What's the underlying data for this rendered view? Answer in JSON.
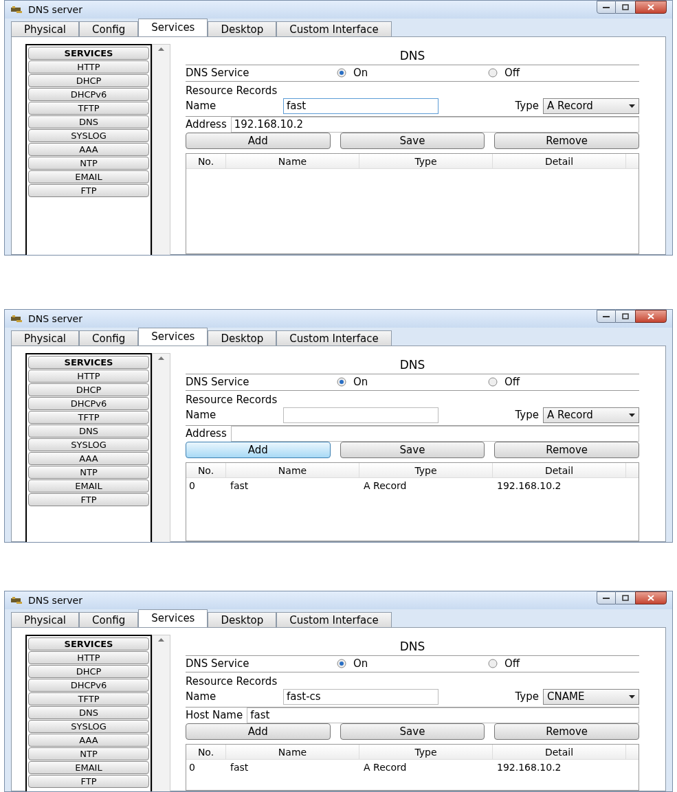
{
  "windows": [
    {
      "title": "DNS server",
      "tabs": [
        {
          "label": "Physical",
          "selected": false
        },
        {
          "label": "Config",
          "selected": false
        },
        {
          "label": "Services",
          "selected": true
        },
        {
          "label": "Desktop",
          "selected": false
        },
        {
          "label": "Custom Interface",
          "selected": false
        }
      ],
      "services": [
        {
          "label": "SERVICES",
          "kind": "header"
        },
        {
          "label": "HTTP",
          "kind": "item"
        },
        {
          "label": "DHCP",
          "kind": "item"
        },
        {
          "label": "DHCPv6",
          "kind": "item"
        },
        {
          "label": "TFTP",
          "kind": "item"
        },
        {
          "label": "DNS",
          "kind": "item"
        },
        {
          "label": "SYSLOG",
          "kind": "item"
        },
        {
          "label": "AAA",
          "kind": "item"
        },
        {
          "label": "NTP",
          "kind": "item"
        },
        {
          "label": "EMAIL",
          "kind": "item"
        },
        {
          "label": "FTP",
          "kind": "item"
        }
      ],
      "heading": "DNS",
      "service_label": "DNS Service",
      "radios": [
        {
          "label": "On",
          "selected": true
        },
        {
          "label": "Off",
          "selected": false
        }
      ],
      "records_label": "Resource Records",
      "name_field": {
        "label": "Name",
        "value": "fast",
        "focused": true
      },
      "type_field": {
        "label": "Type",
        "value": "A Record"
      },
      "detail_field": {
        "label": "Address",
        "value": "192.168.10.2"
      },
      "buttons": [
        {
          "label": "Add",
          "highlighted": false
        },
        {
          "label": "Save",
          "highlighted": false
        },
        {
          "label": "Remove",
          "highlighted": false
        }
      ],
      "columns": [
        "No.",
        "Name",
        "Type",
        "Detail"
      ]
    },
    {
      "title": "DNS server",
      "tabs": [
        {
          "label": "Physical",
          "selected": false
        },
        {
          "label": "Config",
          "selected": false
        },
        {
          "label": "Services",
          "selected": true
        },
        {
          "label": "Desktop",
          "selected": false
        },
        {
          "label": "Custom Interface",
          "selected": false
        }
      ],
      "services": [
        {
          "label": "SERVICES",
          "kind": "header"
        },
        {
          "label": "HTTP",
          "kind": "item"
        },
        {
          "label": "DHCP",
          "kind": "item"
        },
        {
          "label": "DHCPv6",
          "kind": "item"
        },
        {
          "label": "TFTP",
          "kind": "item"
        },
        {
          "label": "DNS",
          "kind": "item"
        },
        {
          "label": "SYSLOG",
          "kind": "item"
        },
        {
          "label": "AAA",
          "kind": "item"
        },
        {
          "label": "NTP",
          "kind": "item"
        },
        {
          "label": "EMAIL",
          "kind": "item"
        },
        {
          "label": "FTP",
          "kind": "item"
        }
      ],
      "heading": "DNS",
      "service_label": "DNS Service",
      "radios": [
        {
          "label": "On",
          "selected": true
        },
        {
          "label": "Off",
          "selected": false
        }
      ],
      "records_label": "Resource Records",
      "name_field": {
        "label": "Name",
        "focused": false
      },
      "type_field": {
        "label": "Type",
        "value": "A Record"
      },
      "detail_field": {
        "label": "Address"
      },
      "buttons": [
        {
          "label": "Add",
          "highlighted": true
        },
        {
          "label": "Save",
          "highlighted": false
        },
        {
          "label": "Remove",
          "highlighted": false
        }
      ],
      "columns": [
        "No.",
        "Name",
        "Type",
        "Detail"
      ],
      "rows": [
        [
          "0",
          "fast",
          "A Record",
          "192.168.10.2"
        ]
      ]
    },
    {
      "title": "DNS server",
      "tabs": [
        {
          "label": "Physical",
          "selected": false
        },
        {
          "label": "Config",
          "selected": false
        },
        {
          "label": "Services",
          "selected": true
        },
        {
          "label": "Desktop",
          "selected": false
        },
        {
          "label": "Custom Interface",
          "selected": false
        }
      ],
      "services": [
        {
          "label": "SERVICES",
          "kind": "header"
        },
        {
          "label": "HTTP",
          "kind": "item"
        },
        {
          "label": "DHCP",
          "kind": "item"
        },
        {
          "label": "DHCPv6",
          "kind": "item"
        },
        {
          "label": "TFTP",
          "kind": "item"
        },
        {
          "label": "DNS",
          "kind": "item"
        },
        {
          "label": "SYSLOG",
          "kind": "item"
        },
        {
          "label": "AAA",
          "kind": "item"
        },
        {
          "label": "NTP",
          "kind": "item"
        },
        {
          "label": "EMAIL",
          "kind": "item"
        },
        {
          "label": "FTP",
          "kind": "item"
        }
      ],
      "heading": "DNS",
      "service_label": "DNS Service",
      "radios": [
        {
          "label": "On",
          "selected": true
        },
        {
          "label": "Off",
          "selected": false
        }
      ],
      "records_label": "Resource Records",
      "name_field": {
        "label": "Name",
        "value": "fast-cs",
        "focused": false
      },
      "type_field": {
        "label": "Type",
        "value": "CNAME"
      },
      "detail_field": {
        "label": "Host Name",
        "value": "fast"
      },
      "buttons": [
        {
          "label": "Add",
          "highlighted": false
        },
        {
          "label": "Save",
          "highlighted": false
        },
        {
          "label": "Remove",
          "highlighted": false
        }
      ],
      "columns": [
        "No.",
        "Name",
        "Type",
        "Detail"
      ],
      "rows": [
        [
          "0",
          "fast",
          "A Record",
          "192.168.10.2"
        ]
      ]
    }
  ]
}
